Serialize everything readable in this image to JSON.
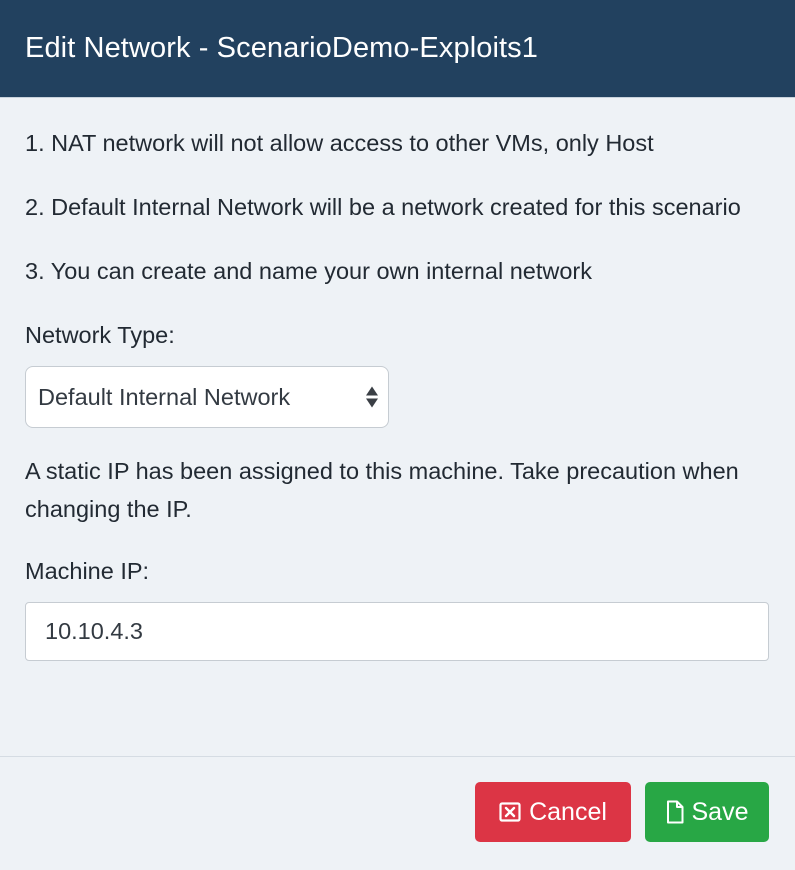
{
  "modal": {
    "title": "Edit Network - ScenarioDemo-Exploits1"
  },
  "notes": {
    "nat": "1. NAT network will not allow access to other VMs, only Host",
    "default_internal": "2. Default Internal Network will be a network created for this scenario",
    "custom": "3. You can create and name your own internal network"
  },
  "network_type": {
    "label": "Network Type:",
    "selected": "Default Internal Network"
  },
  "static_ip_note": "A static IP has been assigned to this machine. Take precaution when changing the IP.",
  "machine_ip": {
    "label": "Machine IP:",
    "value": "10.10.4.3"
  },
  "footer": {
    "cancel_label": "Cancel",
    "save_label": "Save"
  },
  "colors": {
    "header_bg": "#22415f",
    "cancel_bg": "#dc3545",
    "save_bg": "#28a745"
  },
  "icons": {
    "cancel": "close-box-icon",
    "save": "file-icon",
    "select": "sort-arrows-icon"
  }
}
